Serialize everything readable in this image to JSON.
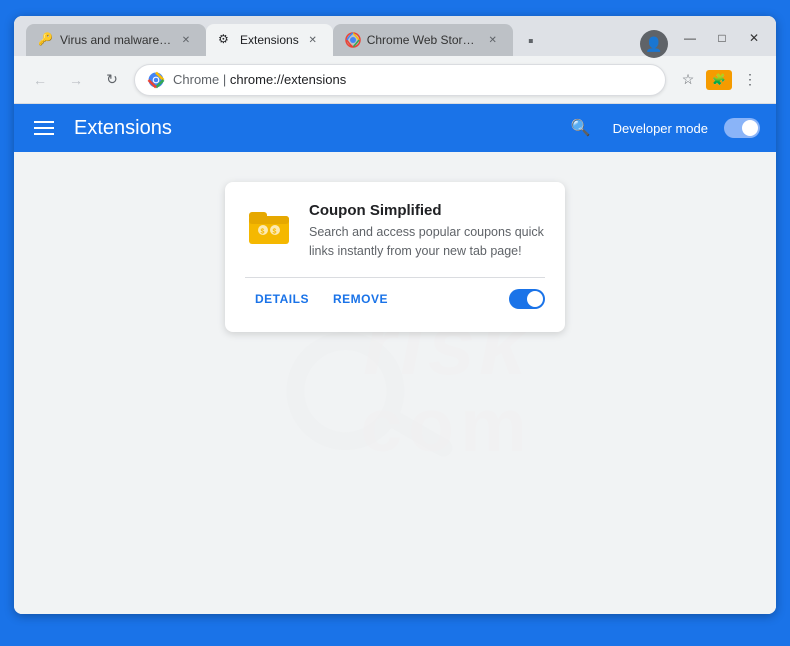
{
  "browser": {
    "window_controls": {
      "minimize": "—",
      "maximize": "□",
      "close": "✕"
    },
    "tabs": [
      {
        "id": "tab-1",
        "title": "Virus and malware remo...",
        "icon": "🔑",
        "active": false
      },
      {
        "id": "tab-2",
        "title": "Extensions",
        "icon": "⚙",
        "active": true
      },
      {
        "id": "tab-3",
        "title": "Chrome Web Store - cou...",
        "icon": "🌐",
        "active": false
      }
    ],
    "omnibox": {
      "site_label": "Chrome",
      "url": "chrome://extensions"
    }
  },
  "extensions_page": {
    "header": {
      "title": "Extensions",
      "search_label": "Search extensions",
      "developer_mode_label": "Developer mode",
      "developer_mode_on": true
    },
    "extension": {
      "name": "Coupon Simplified",
      "description": "Search and access popular coupons quick links instantly from your new tab page!",
      "details_btn": "DETAILS",
      "remove_btn": "REMOVE",
      "enabled": true
    }
  },
  "watermark": {
    "line1": "risk",
    "line2": "com"
  }
}
